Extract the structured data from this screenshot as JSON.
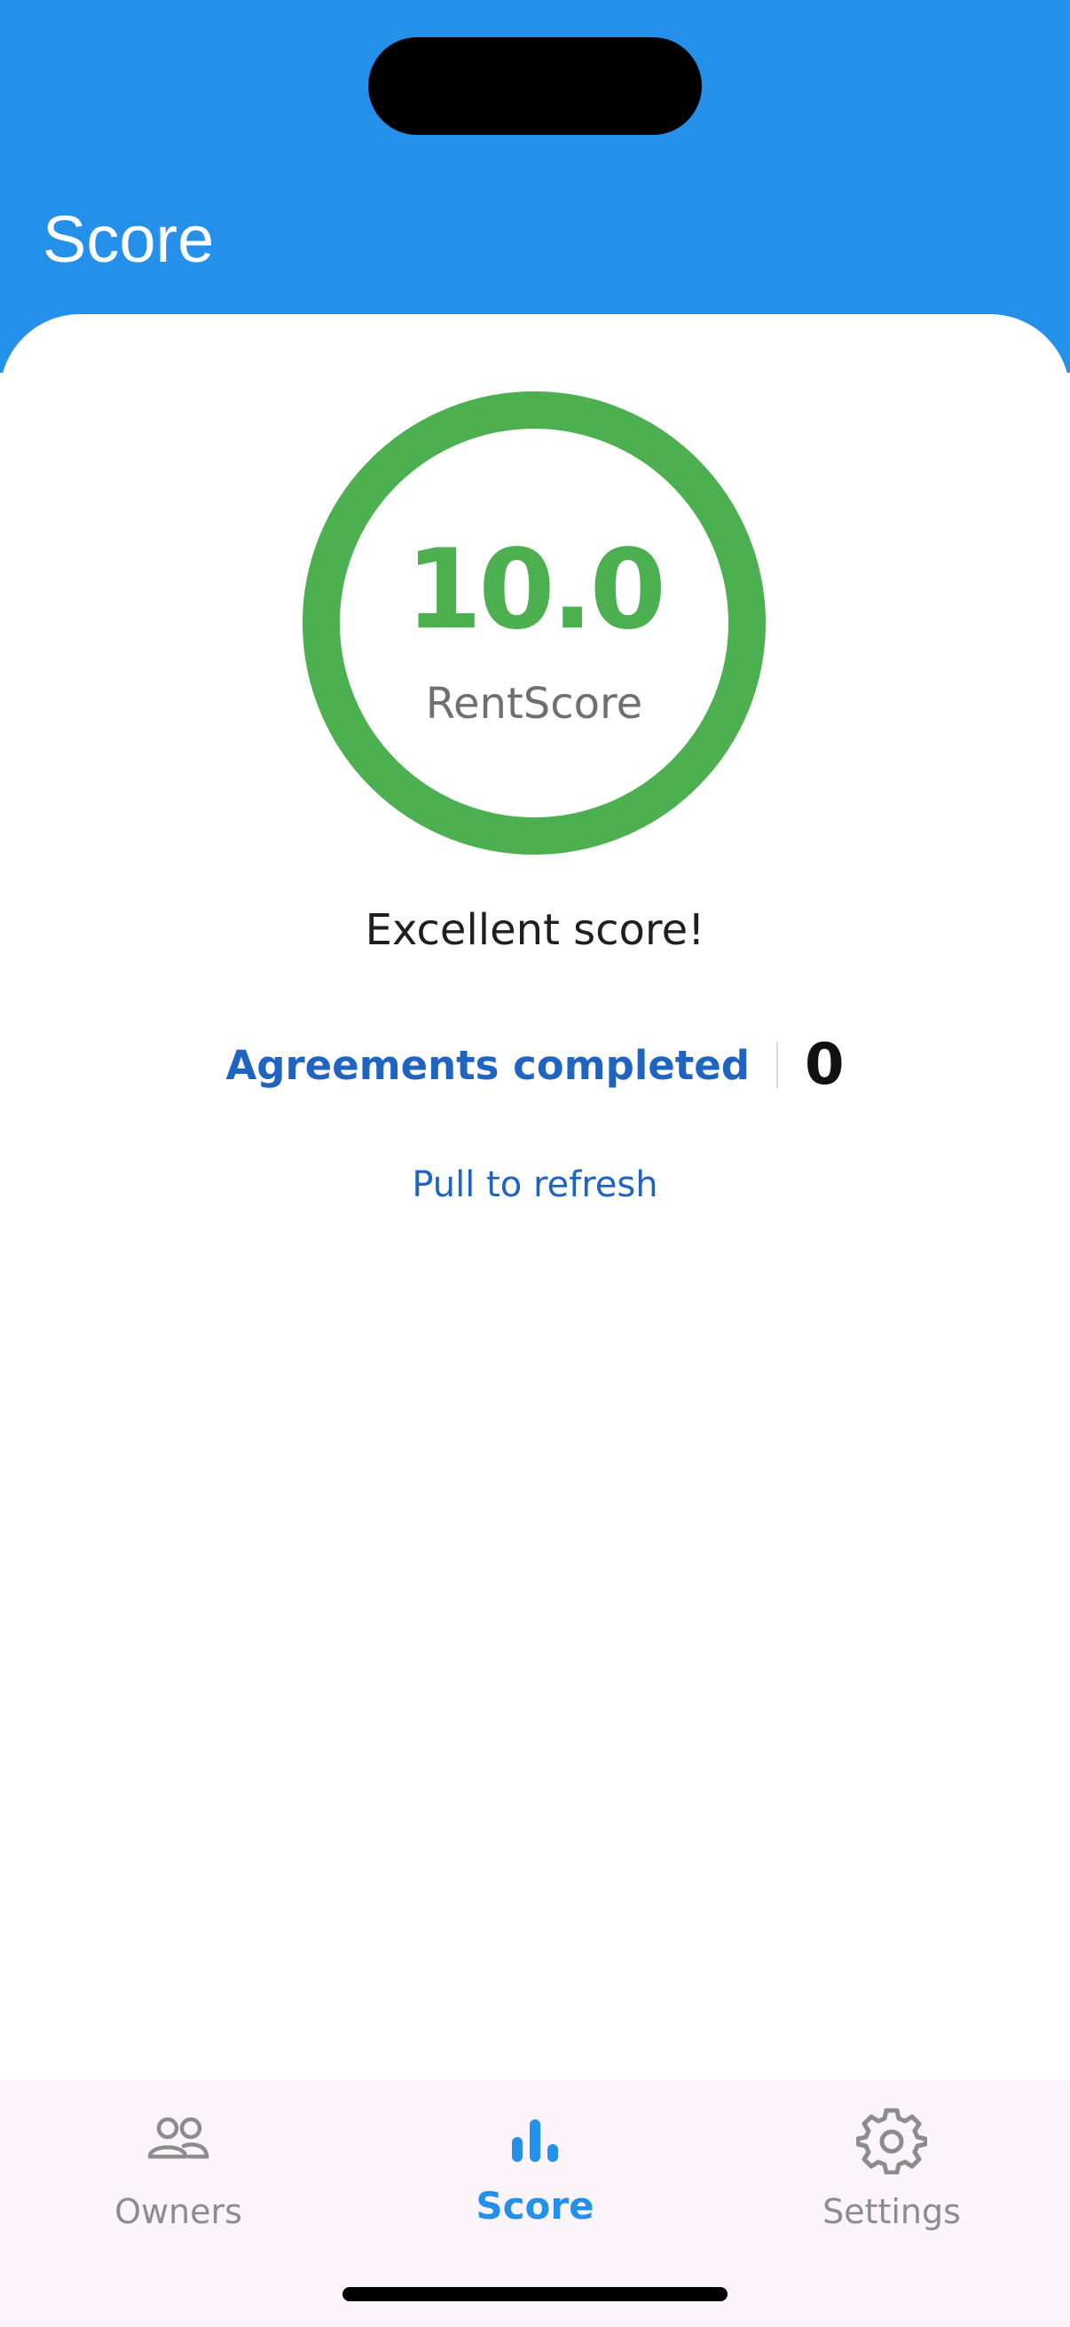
{
  "header": {
    "title": "Score",
    "background_color": "#2590EA"
  },
  "score": {
    "value": "10.0",
    "label": "RentScore",
    "ring_fraction": 1.0,
    "ring_color": "#4CAF50",
    "message": "Excellent score!"
  },
  "agreements": {
    "label": "Agreements completed",
    "value": "0"
  },
  "refresh": {
    "label": "Pull to refresh"
  },
  "tab_bar": {
    "active_color": "#2590EA",
    "inactive_color": "#8c8c8c",
    "tabs": [
      {
        "label": "Owners",
        "icon": "people-icon",
        "active": false
      },
      {
        "label": "Score",
        "icon": "bar-chart-icon",
        "active": true
      },
      {
        "label": "Settings",
        "icon": "gear-icon",
        "active": false
      }
    ]
  }
}
